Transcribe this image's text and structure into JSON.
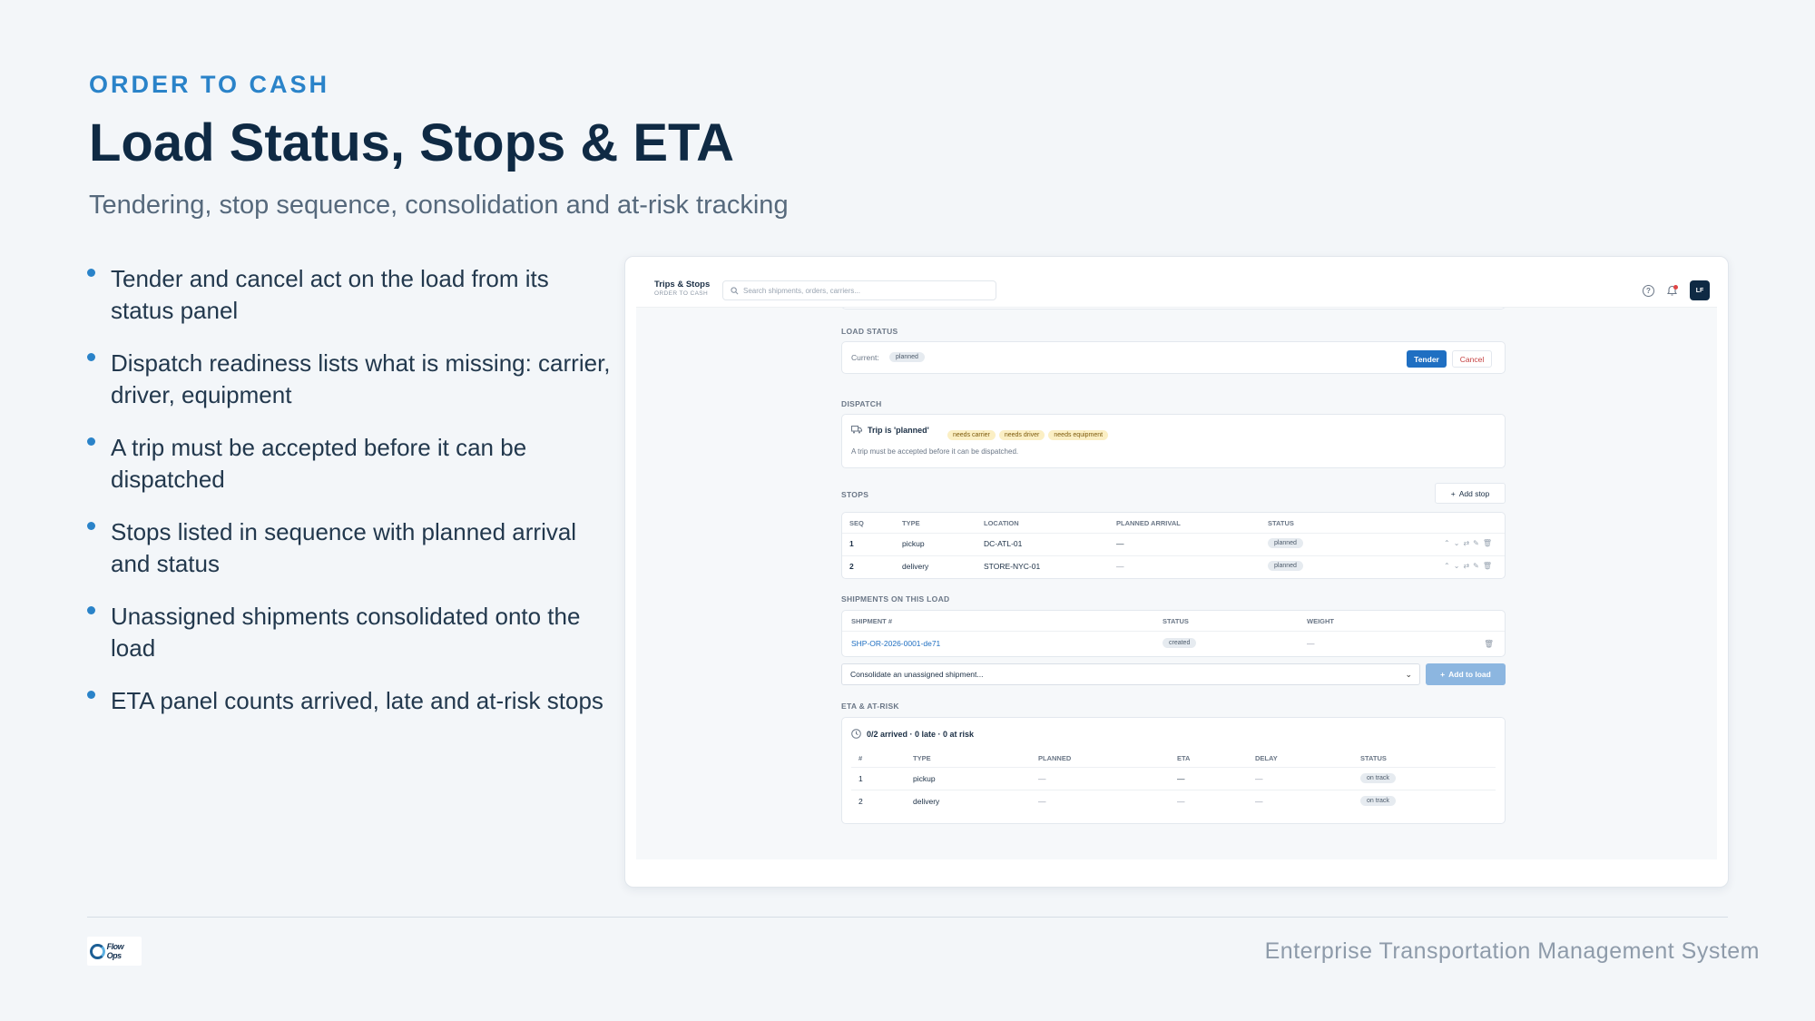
{
  "slide": {
    "eyebrow": "ORDER TO CASH",
    "title": "Load Status, Stops & ETA",
    "subtitle": "Tendering, stop sequence, consolidation and at-risk tracking",
    "bullets": [
      "Tender and cancel act on the load from its status panel",
      "Dispatch readiness lists what is missing: carrier, driver, equipment",
      "A trip must be accepted before it can be dispatched",
      "Stops listed in sequence with planned arrival and status",
      "Unassigned shipments consolidated onto the load",
      "ETA panel counts arrived, late and at-risk stops"
    ],
    "footer": "Enterprise Transportation Management System",
    "logo_text": "Flow Ops"
  },
  "app": {
    "brand_title": "Trips & Stops",
    "brand_sub": "ORDER TO CASH",
    "search_placeholder": "Search shipments, orders, carriers...",
    "help_icon": "question-circle-icon",
    "bell_icon": "bell-icon",
    "avatar": "LF",
    "accent": "#1f6fc2"
  },
  "load_status": {
    "label": "LOAD STATUS",
    "current_label": "Current:",
    "current_value": "planned",
    "tender": "Tender",
    "cancel": "Cancel"
  },
  "dispatch": {
    "label": "DISPATCH",
    "trip": "Trip is 'planned'",
    "needs": [
      "needs carrier",
      "needs driver",
      "needs equipment"
    ],
    "note": "A trip must be accepted before it can be dispatched."
  },
  "stops": {
    "label": "STOPS",
    "add": "Add stop",
    "columns": [
      "SEQ",
      "TYPE",
      "LOCATION",
      "PLANNED ARRIVAL",
      "STATUS"
    ],
    "rows": [
      {
        "seq": "1",
        "type": "pickup",
        "location": "DC-ATL-01",
        "planned": "—",
        "status": "planned"
      },
      {
        "seq": "2",
        "type": "delivery",
        "location": "STORE-NYC-01",
        "planned": "—",
        "status": "planned"
      }
    ]
  },
  "shipments": {
    "label": "SHIPMENTS ON THIS LOAD",
    "columns": [
      "SHIPMENT #",
      "STATUS",
      "WEIGHT"
    ],
    "rows": [
      {
        "id": "SHP-OR-2026-0001-de71",
        "status": "created",
        "weight": "—"
      }
    ],
    "select_value": "Consolidate an unassigned shipment...",
    "add": "Add to load"
  },
  "eta": {
    "label": "ETA & AT-RISK",
    "summary": "0/2 arrived · 0 late · 0 at risk",
    "columns": [
      "#",
      "TYPE",
      "PLANNED",
      "ETA",
      "DELAY",
      "STATUS"
    ],
    "rows": [
      {
        "n": "1",
        "type": "pickup",
        "planned": "—",
        "eta": "—",
        "delay": "—",
        "status": "on track"
      },
      {
        "n": "2",
        "type": "delivery",
        "planned": "—",
        "eta": "—",
        "delay": "—",
        "status": "on track"
      }
    ]
  }
}
